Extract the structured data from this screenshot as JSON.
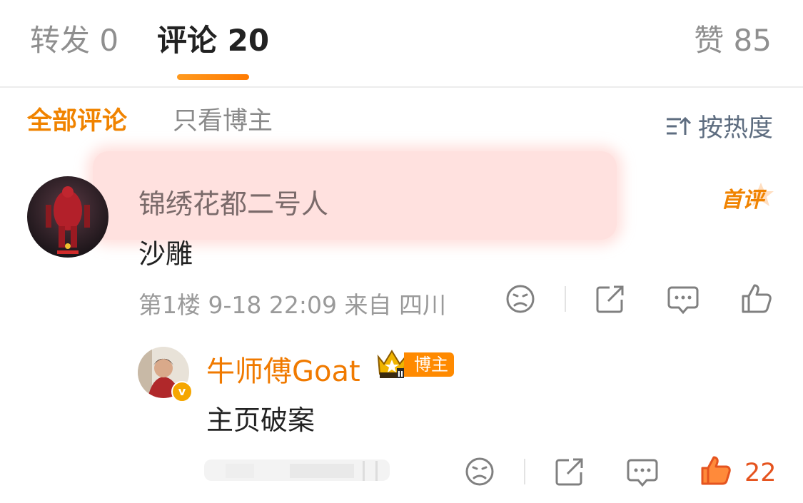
{
  "tabs": {
    "repost_label": "转发 0",
    "comments_label": "评论 20",
    "likes_label": "赞 85"
  },
  "filters": {
    "all_label": "全部评论",
    "author_only_label": "只看博主",
    "sort_label": "按热度",
    "sort_icon": "sort-icon"
  },
  "comments": [
    {
      "username": "锦绣花都二号人",
      "badge": "首评",
      "text": "沙雕",
      "meta": "第1楼 9-18 22:09 来自 四川",
      "avatar": "avatar-red-robot"
    }
  ],
  "reply": {
    "username": "牛师傅Goat",
    "badge_label": "博主",
    "verified_mark": "v",
    "text": "主页破案",
    "likes": "22",
    "avatar": "avatar-person"
  },
  "colors": {
    "accent": "#F08300",
    "like_active": "#E5541F",
    "highlight": "#FFE1DF"
  },
  "icons": [
    "dislike-icon",
    "share-icon",
    "comment-icon",
    "like-icon"
  ]
}
